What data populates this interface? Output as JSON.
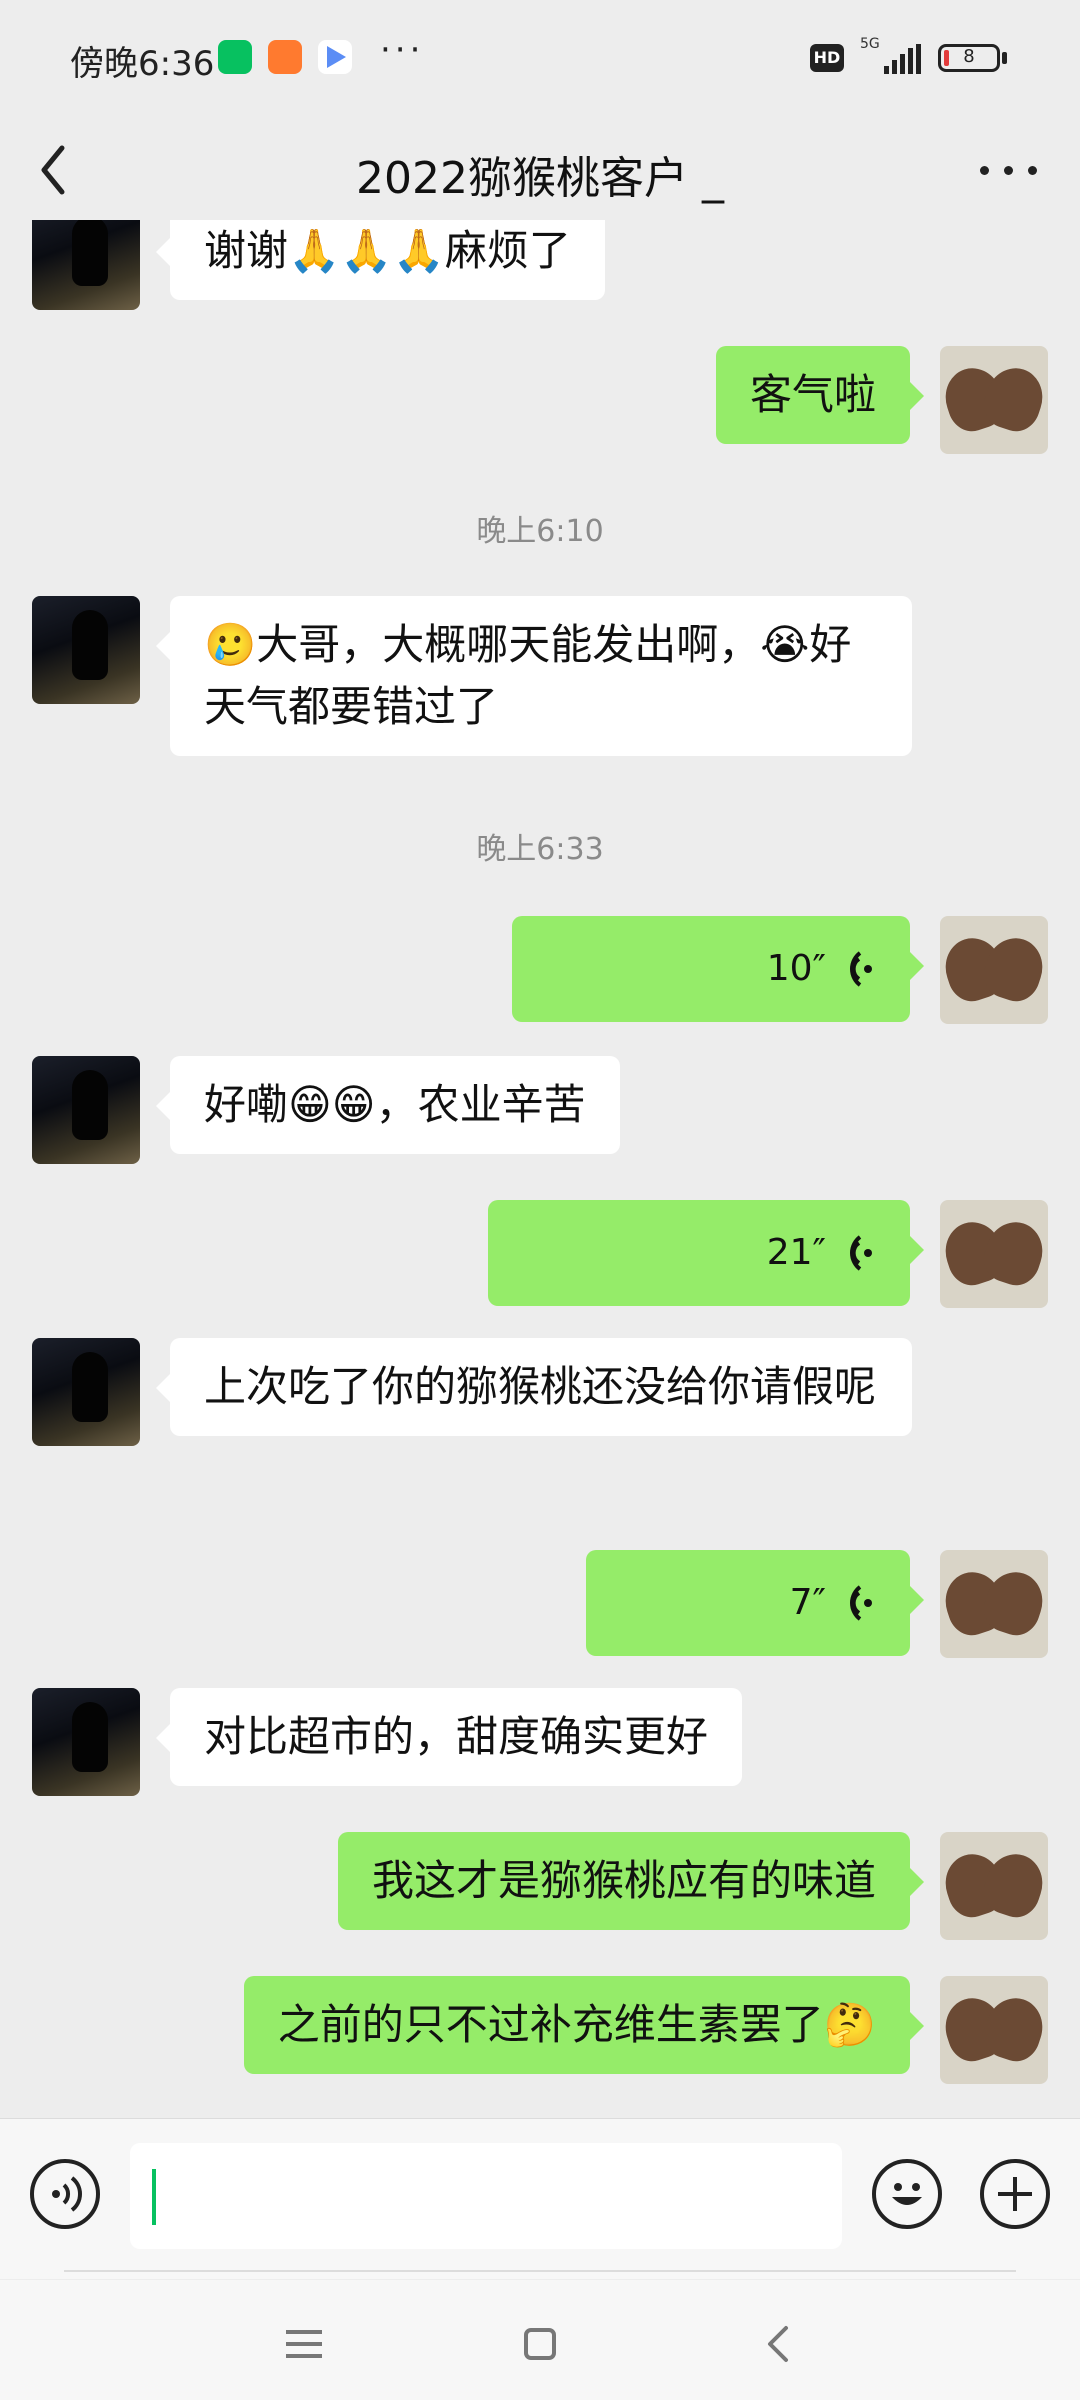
{
  "status_bar": {
    "time": "傍晚6:36",
    "more": "···",
    "hd": "HD",
    "network": "5G",
    "battery": "8",
    "accent_battery": "#e23b3b"
  },
  "header": {
    "title": "2022猕猴桃客户 _"
  },
  "messages": [
    {
      "side": "left",
      "text": "谢谢🙏🙏🙏麻烦了"
    },
    {
      "side": "right",
      "text": "客气啦"
    },
    {
      "side": "time",
      "text": "晚上6:10"
    },
    {
      "side": "left",
      "text": "🥲大哥，大概哪天能发出啊，😭好天气都要错过了"
    },
    {
      "side": "time",
      "text": "晚上6:33"
    },
    {
      "side": "right",
      "type": "voice",
      "duration": "10″"
    },
    {
      "side": "left",
      "text": "好嘞😁😁，农业辛苦"
    },
    {
      "side": "right",
      "type": "voice",
      "duration": "21″"
    },
    {
      "side": "left",
      "text": "上次吃了你的猕猴桃还没给你请假呢"
    },
    {
      "side": "right",
      "type": "voice",
      "duration": "7″"
    },
    {
      "side": "left",
      "text": "对比超市的，甜度确实更好"
    },
    {
      "side": "right",
      "text": "我这才是猕猴桃应有的味道"
    },
    {
      "side": "right",
      "text": "之前的只不过补充维生素罢了🤔"
    }
  ],
  "input": {
    "value": "",
    "placeholder": ""
  },
  "colors": {
    "sent_bubble": "#95ec69",
    "received_bubble": "#ffffff",
    "background": "#ededed",
    "cursor": "#07c160"
  },
  "icons": [
    "back-arrow-icon",
    "more-icon",
    "voice-wave-icon",
    "voice-input-icon",
    "emoji-icon",
    "plus-icon",
    "menu-icon",
    "home-icon",
    "back-icon"
  ]
}
